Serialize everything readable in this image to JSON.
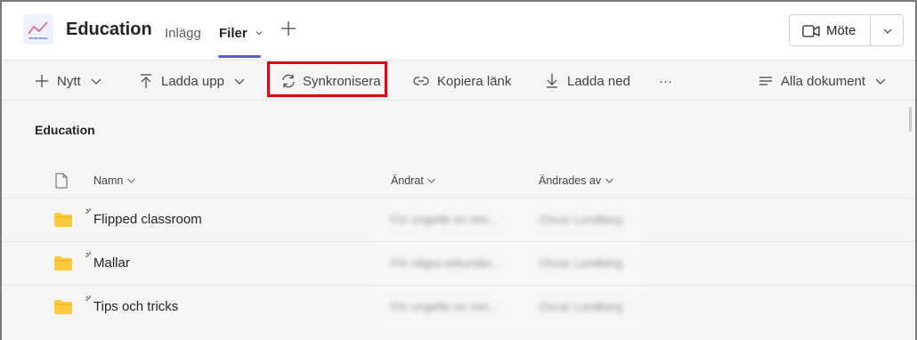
{
  "header": {
    "title": "Education",
    "tabs": [
      {
        "label": "Inlägg"
      },
      {
        "label": "Filer"
      }
    ],
    "meet_label": "Möte"
  },
  "toolbar": {
    "new_label": "Nytt",
    "upload_label": "Ladda upp",
    "sync_label": "Synkronisera",
    "copy_link_label": "Kopiera länk",
    "download_label": "Ladda ned",
    "more_label": "···",
    "view_label": "Alla dokument"
  },
  "breadcrumb": "Education",
  "table": {
    "columns": [
      "Namn",
      "Ändrat",
      "Ändrades av"
    ],
    "rows": [
      {
        "name": "Flipped classroom",
        "modified": "För ungefär en min...",
        "modified_by": "Oscar Lundberg"
      },
      {
        "name": "Mallar",
        "modified": "För några sekunder...",
        "modified_by": "Oscar Lundberg"
      },
      {
        "name": "Tips och tricks",
        "modified": "För ungefär en min...",
        "modified_by": "Oscar Lundberg"
      }
    ]
  },
  "colors": {
    "accent": "#5b5fc7",
    "highlight": "#e8000b",
    "folder": "#ffc83d"
  }
}
